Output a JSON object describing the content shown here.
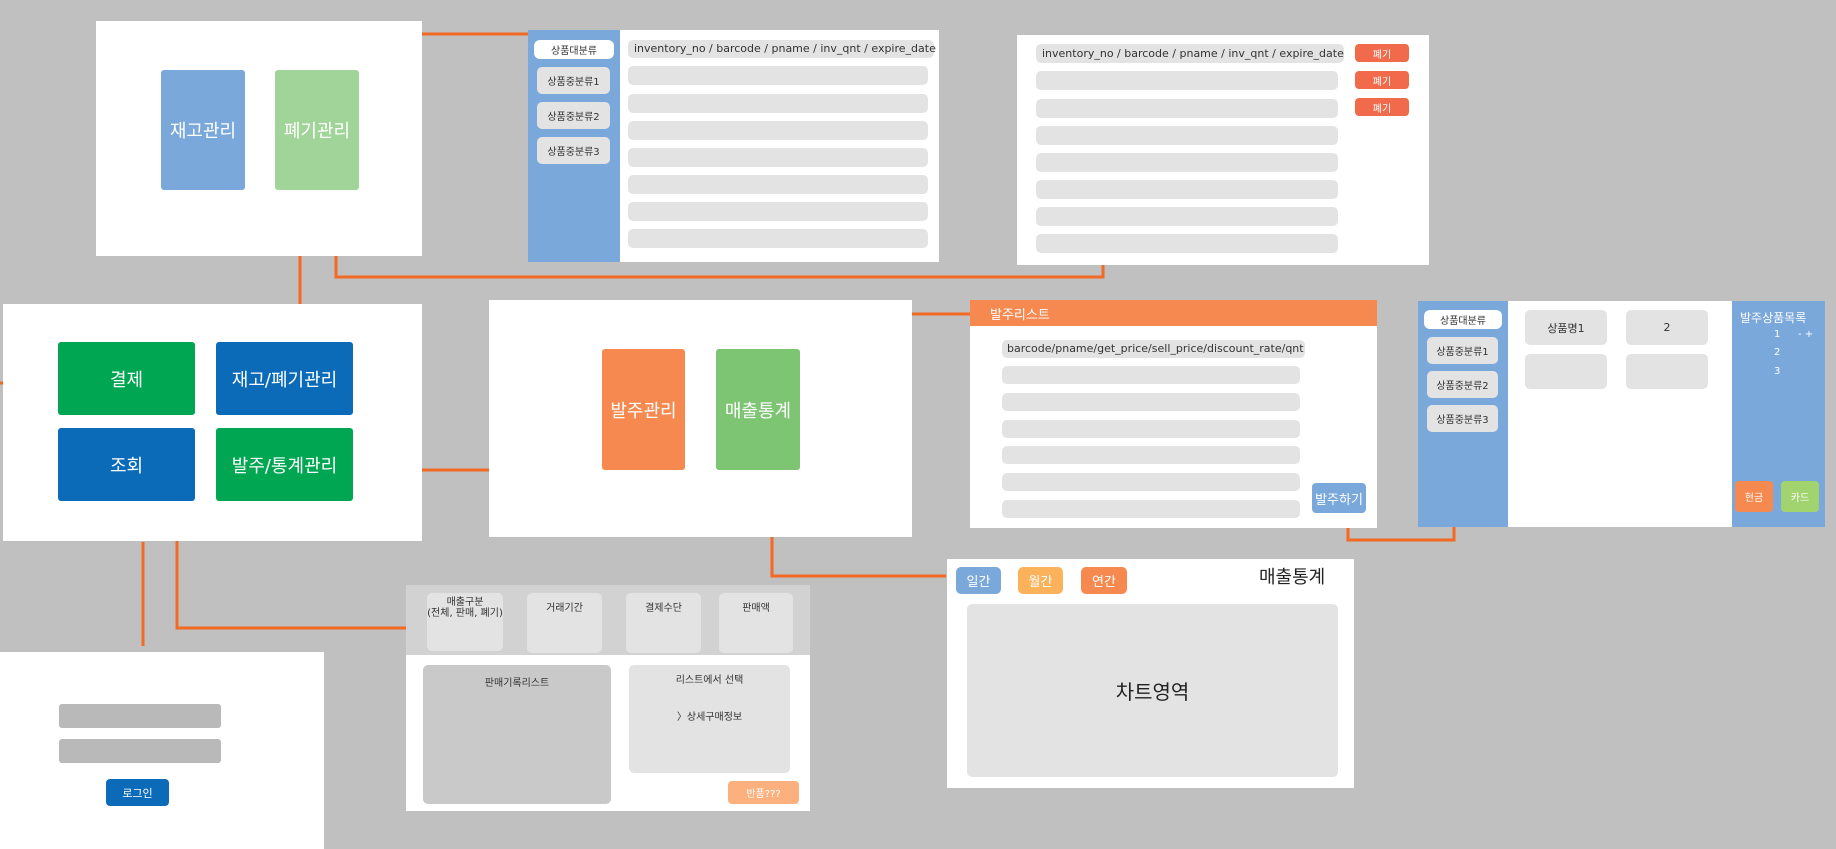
{
  "colors": {
    "connector": "#f26a24",
    "blue_button": "#7aa8db",
    "green_button": "#a1d499",
    "dark_green": "#00a651",
    "dark_blue": "#0b6bb8",
    "orange_button": "#f5894f",
    "red_button": "#f06a4b"
  },
  "inventory_menu": {
    "stock_manage": "재고관리",
    "disposal_manage": "폐기관리"
  },
  "category_panel_1": {
    "major": "상품대분류",
    "minors": [
      "상품중분류1",
      "상품중분류2",
      "상품중분류3"
    ],
    "header": "inventory_no / barcode / pname / inv_qnt / expire_date"
  },
  "disposal_panel": {
    "header": "inventory_no / barcode / pname / inv_qnt / expire_date",
    "dispose_buttons": [
      "폐기",
      "폐기",
      "폐기"
    ]
  },
  "main_menu": {
    "payment": "결제",
    "inventory_disposal": "재고/폐기관리",
    "lookup": "조회",
    "order_stats": "발주/통계관리"
  },
  "order_stats_menu": {
    "order_manage": "발주관리",
    "sales_stats": "매출통계"
  },
  "order_list": {
    "title": "발주리스트",
    "header": "barcode/pname/get_price/sell_price/discount_rate/qnt",
    "order_button": "발주하기"
  },
  "order_panel": {
    "major": "상품대분류",
    "minors": [
      "상품중분류1",
      "상품중분류2",
      "상품중분류3"
    ],
    "product_name": "상품명1",
    "quantity": "2",
    "side_title": "발주상품목록",
    "side_rows": [
      "1",
      "2",
      "3"
    ],
    "stepper": "- +",
    "cash": "현금",
    "card": "카드"
  },
  "sales_stats": {
    "daily": "일간",
    "monthly": "월간",
    "yearly": "연간",
    "title": "매출통계",
    "chart_area": "차트영역"
  },
  "lookup_panel": {
    "filter_type": "매출구분\n(전체, 판매, 폐기)",
    "filter_period": "거래기간",
    "filter_payment": "결제수단",
    "filter_amount": "판매액",
    "list_title": "판매기록리스트",
    "select_hint": "리스트에서 선택",
    "detail": "〉상세구매정보",
    "refund": "반품???"
  },
  "login_panel": {
    "login_button": "로그인"
  }
}
